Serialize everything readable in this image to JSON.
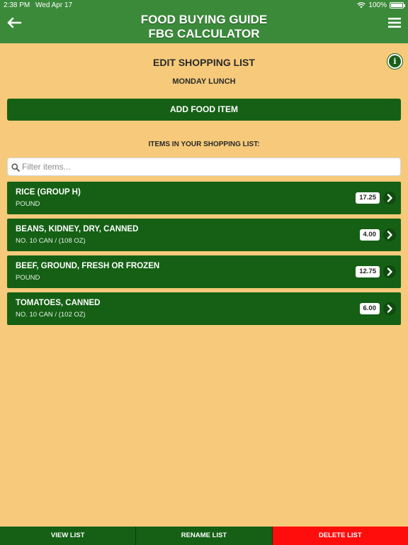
{
  "status": {
    "time": "2:38 PM",
    "date": "Wed Apr 17",
    "battery": "100%"
  },
  "header": {
    "title_line1": "FOOD BUYING GUIDE",
    "title_line2": "FBG CALCULATOR",
    "color": "#3b8a3a"
  },
  "page": {
    "title": "EDIT SHOPPING LIST",
    "list_name": "MONDAY LUNCH",
    "info_icon": "i"
  },
  "add_button": {
    "label": "ADD FOOD ITEM",
    "color": "#156015"
  },
  "items_section": {
    "label": "ITEMS IN YOUR SHOPPING LIST:"
  },
  "search": {
    "placeholder": "Filter items...",
    "value": ""
  },
  "items": [
    {
      "name": "RICE (GROUP H)",
      "unit": "POUND",
      "qty": "17.25"
    },
    {
      "name": "BEANS, KIDNEY, DRY, CANNED",
      "unit": "NO. 10 CAN / (108 OZ)",
      "qty": "4.00"
    },
    {
      "name": "BEEF, GROUND, FRESH OR FROZEN",
      "unit": "POUND",
      "qty": "12.75"
    },
    {
      "name": "TOMATOES, CANNED",
      "unit": "NO. 10 CAN / (102 OZ)",
      "qty": "6.00"
    }
  ],
  "bottom_bar": {
    "view": {
      "label": "VIEW LIST",
      "color": "#156015"
    },
    "rename": {
      "label": "RENAME LIST",
      "color": "#156015"
    },
    "delete": {
      "label": "DELETE LIST",
      "color": "#ff0d0d"
    }
  },
  "colors": {
    "background": "#f6ca7a",
    "accent": "#156015",
    "danger": "#ff0d0d"
  }
}
